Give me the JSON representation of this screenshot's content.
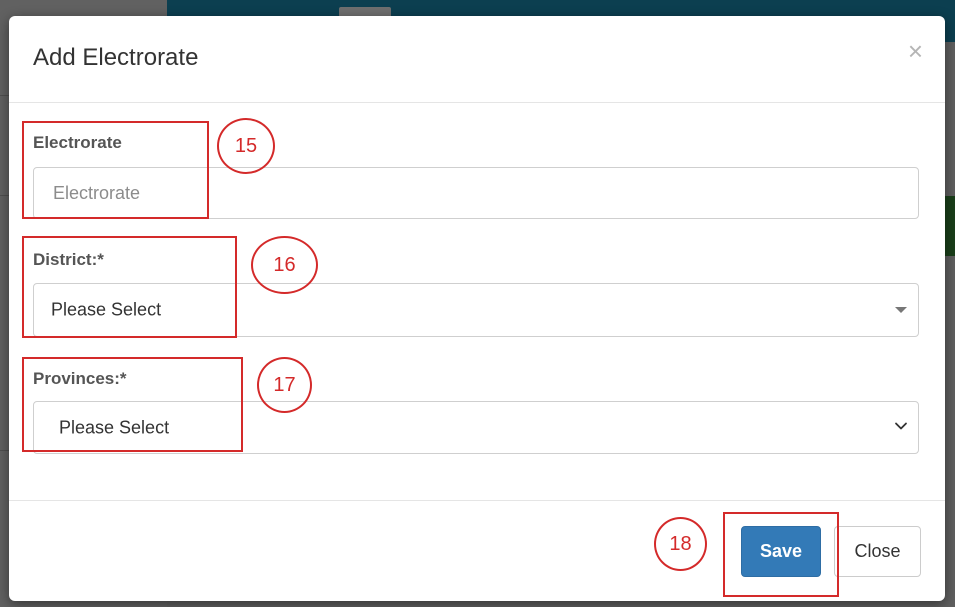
{
  "modal": {
    "title": "Add Electrorate",
    "close_symbol": "×"
  },
  "form": {
    "electrorate": {
      "label": "Electrorate",
      "placeholder": "Electrorate",
      "value": ""
    },
    "district": {
      "label": "District:*",
      "selected": "Please Select",
      "icon": "caret-down-icon"
    },
    "provinces": {
      "label": "Provinces:*",
      "selected": "Please Select",
      "icon": "chevron-down-icon"
    }
  },
  "footer": {
    "save_label": "Save",
    "close_label": "Close"
  },
  "annotations": {
    "color": "#d42a2a",
    "markers": [
      "15",
      "16",
      "17",
      "18"
    ]
  },
  "colors": {
    "primary_button": "#337ab7",
    "background_topbar": "#0c3f50"
  }
}
